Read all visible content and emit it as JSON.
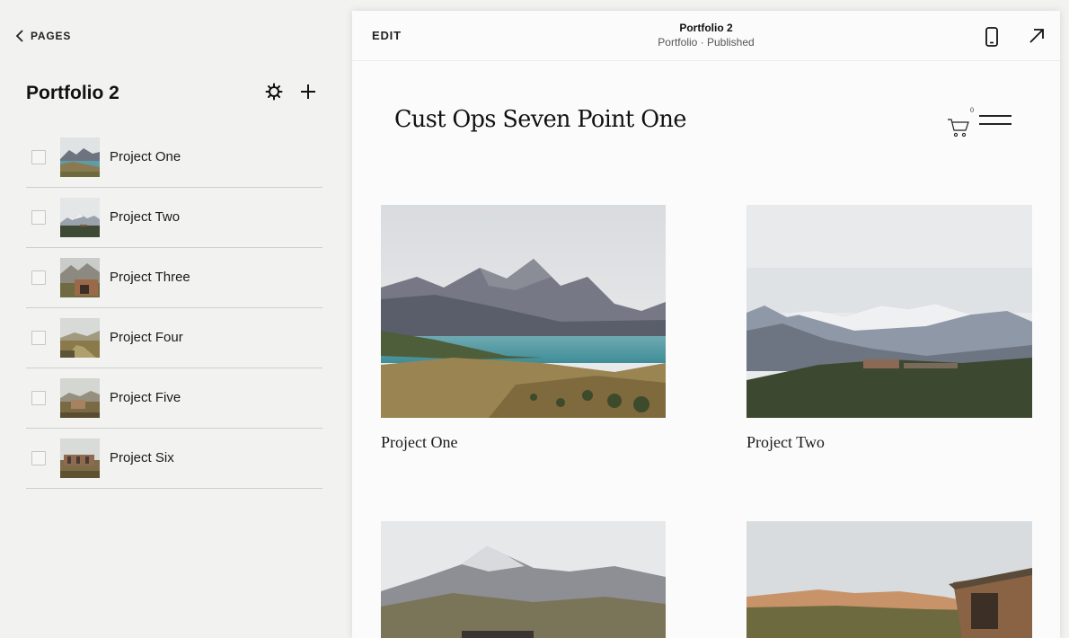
{
  "sidebar": {
    "back_label": "PAGES",
    "title": "Portfolio 2",
    "items": [
      {
        "label": "Project One"
      },
      {
        "label": "Project Two"
      },
      {
        "label": "Project Three"
      },
      {
        "label": "Project Four"
      },
      {
        "label": "Project Five"
      },
      {
        "label": "Project Six"
      }
    ]
  },
  "topbar": {
    "edit_label": "EDIT",
    "title": "Portfolio 2",
    "subtitle": "Portfolio · Published"
  },
  "site": {
    "title": "Cust Ops Seven Point One",
    "cart_count": "0",
    "grid": [
      {
        "label": "Project One"
      },
      {
        "label": "Project Two"
      }
    ]
  },
  "colors": {
    "sidebar_bg": "#f2f2f1",
    "preview_bg": "#fafbfa",
    "divider": "#cfcfcd"
  },
  "icons": [
    "chevron-left-icon",
    "gear-icon",
    "plus-icon",
    "mobile-phone-icon",
    "open-external-icon",
    "cart-icon",
    "hamburger-menu-icon"
  ]
}
